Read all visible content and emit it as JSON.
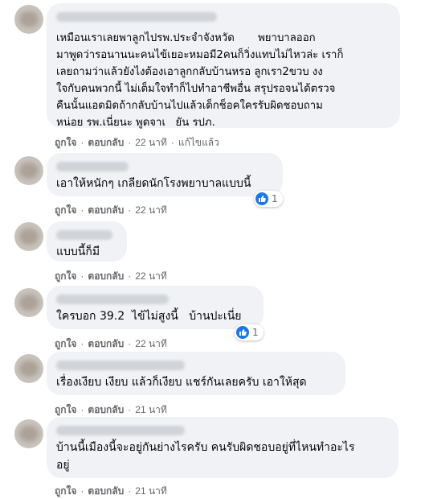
{
  "comments": [
    {
      "text": "เหมือนเราเลยพาลูกไปรพ.ประจำจังหวัด       พยาบาลออก\nมาพูดว่ารอนานนะคนไข้เยอะหมอมี2คนก็วิ่งแทบไม่ไหวล่ะ เราก็\nเลยถามว่าแล้วยังไงต้องเอาลูกกลับบ้านหรอ ลูกเรา2ขวบ งง\nใจกับคนพวกนี้ ไม่เต็มใจทำก็ไปทำอาชีพอื่น สรุปรอจนได้ตรวจ\nคืนนั้นแอดมิดถ้ากลับบ้านไปแล้วเด็กช็อคใครรับผิดชอบถาม\nหน่อย รพ.เนี่ยนะ พูดจาเ   ยัน รปภ.",
      "like": "ถูกใจ",
      "reply": "ตอบกลับ",
      "time": "22 นาที",
      "edited": "แก้ไขแล้ว"
    },
    {
      "text": "เอาให้หนักๆ เกลียดนักโรงพยาบาลแบบนี้",
      "like": "ถูกใจ",
      "reply": "ตอบกลับ",
      "time": "22 นาที",
      "reactions": "1"
    },
    {
      "text": "แบบนี้ก็มี",
      "like": "ถูกใจ",
      "reply": "ตอบกลับ",
      "time": "22 นาที"
    },
    {
      "text": "ใครบอก 39.2  ไข้ไม่สูงนี้   บ้านปะเนี่ย",
      "like": "ถูกใจ",
      "reply": "ตอบกลับ",
      "time": "22 นาที",
      "reactions": "1"
    },
    {
      "text": "เรื่องเงียบ เงียบ แล้วก็เงียบ แชร์กันเลยครับ เอาให้สุด",
      "like": "ถูกใจ",
      "reply": "ตอบกลับ",
      "time": "21 นาที"
    },
    {
      "text": "บ้านนี้เมืองนี้จะอยู่กันย่างไรครับ คนรับผิดชอบอยู่ที่ไหนทำอะไร\nอยู่",
      "like": "ถูกใจ",
      "reply": "ตอบกลับ",
      "time": "21 นาที"
    }
  ],
  "meta_separator": "·",
  "colors": {
    "bubble": "#f0f2f5",
    "meta": "#65676b",
    "like_blue": "#1877f2"
  },
  "icons": {
    "reaction": "like-icon"
  }
}
